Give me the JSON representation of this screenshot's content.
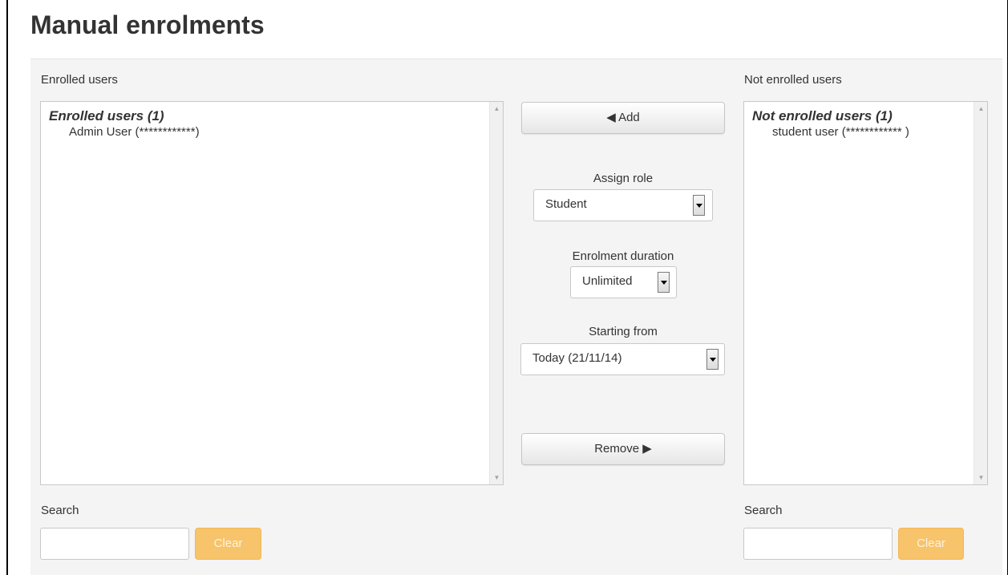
{
  "page": {
    "title": "Manual enrolments"
  },
  "enrolled": {
    "column_label": "Enrolled users",
    "group_label": "Enrolled users (1)",
    "options": [
      "Admin User (************)"
    ]
  },
  "not_enrolled": {
    "column_label": "Not enrolled users",
    "group_label": "Not enrolled users (1)",
    "options": [
      "student user (************ )"
    ]
  },
  "actions": {
    "add_label": "◀ Add",
    "remove_label": "Remove ▶"
  },
  "assign_role": {
    "label": "Assign role",
    "value": "Student"
  },
  "enrolment_duration": {
    "label": "Enrolment duration",
    "value": "Unlimited"
  },
  "starting_from": {
    "label": "Starting from",
    "value": "Today (21/11/14)"
  },
  "search_left": {
    "label": "Search",
    "value": "",
    "clear_label": "Clear"
  },
  "search_right": {
    "label": "Search",
    "value": "",
    "clear_label": "Clear"
  },
  "colors": {
    "clear_button": "#f7c36b",
    "panel_bg": "#f4f4f4"
  }
}
